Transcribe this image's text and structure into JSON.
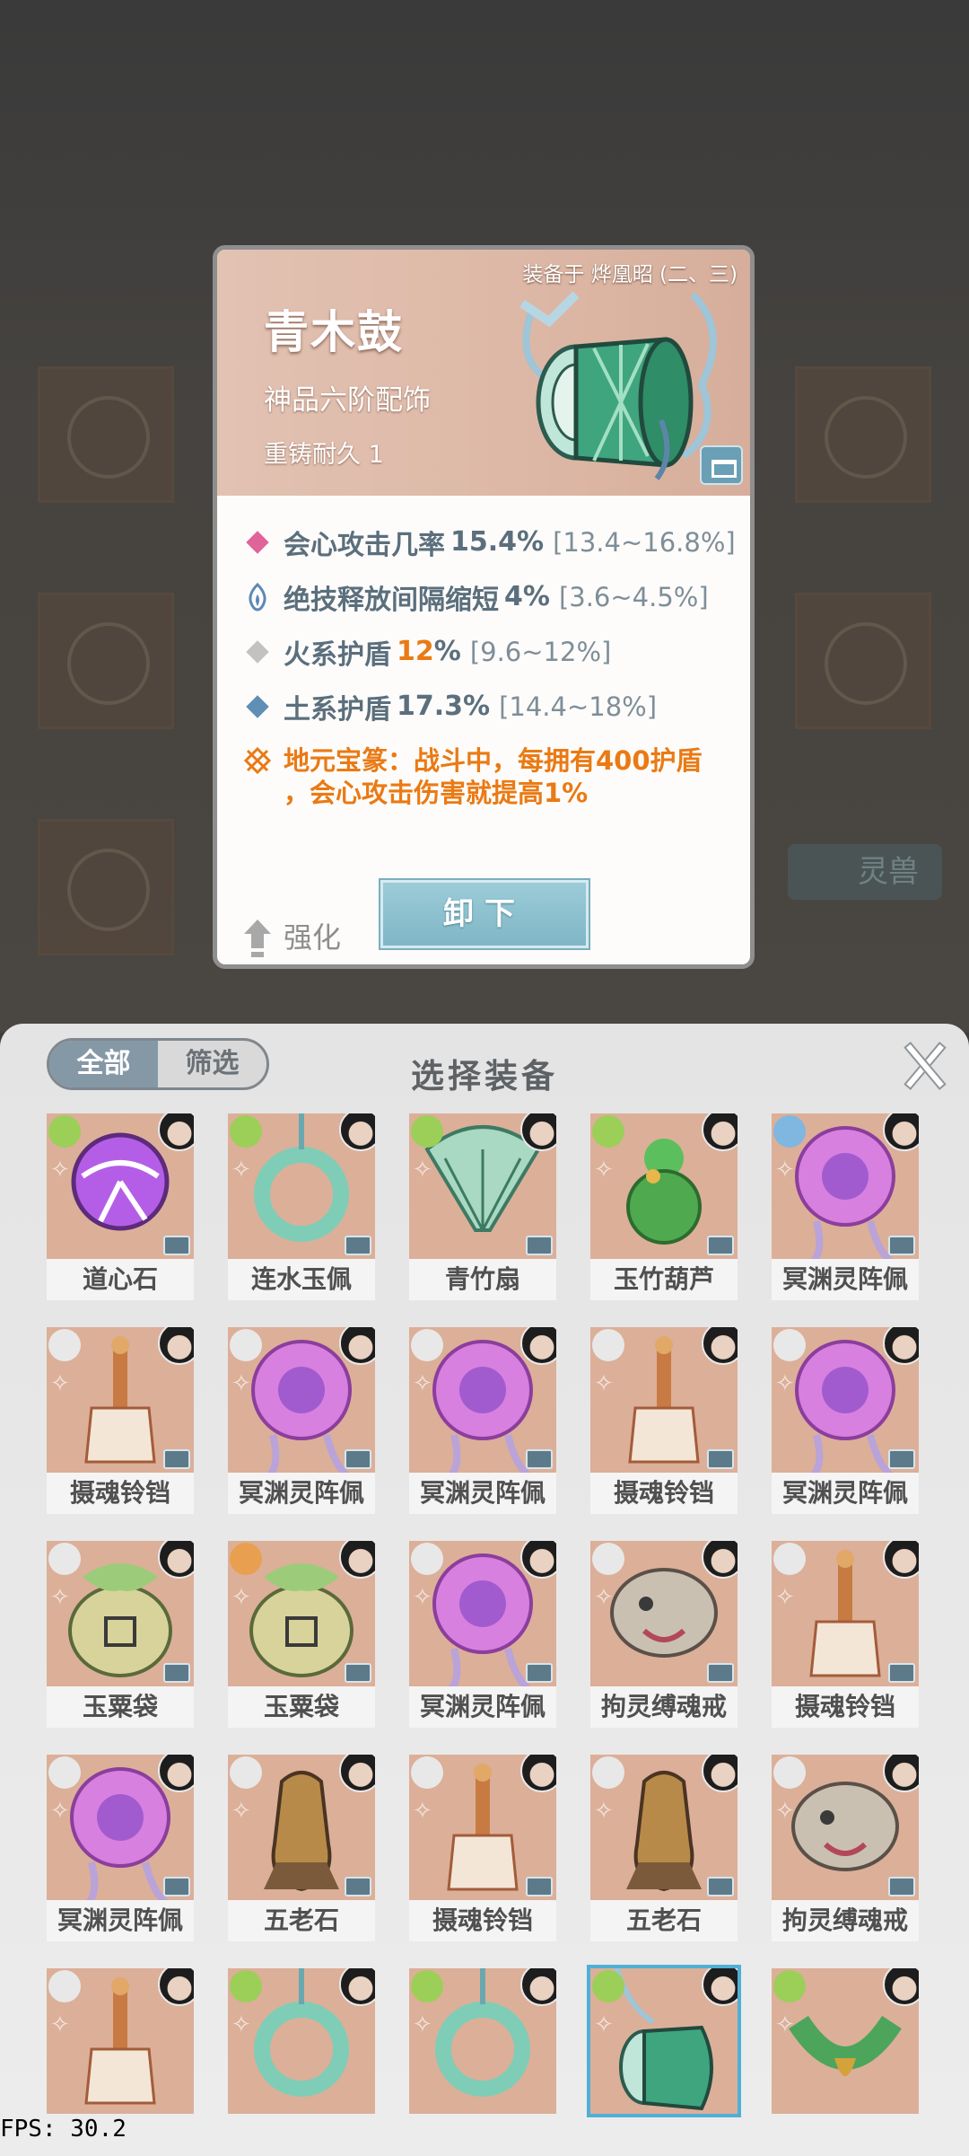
{
  "background": {
    "side_button_label": "灵兽"
  },
  "detail": {
    "equipped_on": "装备于 烨凰昭 (二、三)",
    "name": "青木鼓",
    "grade": "神品六阶配饰",
    "reforge": "重铸耐久 1",
    "stats": [
      {
        "icon": "pink-diamond-icon",
        "color": "#e0649a",
        "name": "会心攻击几率",
        "value": "15.4%",
        "range": "[13.4~16.8%]"
      },
      {
        "icon": "blue-flame-icon",
        "color": "#5c88b8",
        "name": "绝技释放间隔缩短",
        "value": "4%",
        "range": "[3.6~4.5%]"
      },
      {
        "icon": "gray-diamond-icon",
        "color": "#c2c2c2",
        "name": "火系护盾",
        "value_number": "12",
        "value_unit": "%",
        "range": "[9.6~12%]"
      },
      {
        "icon": "blue-diamond-icon",
        "color": "#5f8fb4",
        "name": "土系护盾",
        "value": "17.3%",
        "range": "[14.4~18%]"
      }
    ],
    "special_line1": "地元宝篆：战斗中，每拥有400护盾",
    "special_line2": "，会心攻击伤害就提高1%",
    "strengthen_label": "强化",
    "unload_label": "卸下"
  },
  "panel": {
    "title": "选择装备",
    "tabs": [
      "全部",
      "筛选"
    ],
    "items": [
      {
        "name": "道心石",
        "art": "purple-orb",
        "element": "#9ccf57"
      },
      {
        "name": "连水玉佩",
        "art": "jade-ring",
        "element": "#9ccf57"
      },
      {
        "name": "青竹扇",
        "art": "fan",
        "element": "#9ccf57"
      },
      {
        "name": "玉竹葫芦",
        "art": "gourd",
        "element": "#9ccf57"
      },
      {
        "name": "冥渊灵阵佩",
        "art": "pink-seal",
        "element": "#7fb7e0"
      },
      {
        "name": "摄魂铃铛",
        "art": "bell",
        "element": "#e8e8e8"
      },
      {
        "name": "冥渊灵阵佩",
        "art": "pink-seal",
        "element": "#e8e8e8"
      },
      {
        "name": "冥渊灵阵佩",
        "art": "pink-seal",
        "element": "#e8e8e8"
      },
      {
        "name": "摄魂铃铛",
        "art": "bell",
        "element": "#e8e8e8"
      },
      {
        "name": "冥渊灵阵佩",
        "art": "pink-seal",
        "element": "#e8e8e8"
      },
      {
        "name": "玉粟袋",
        "art": "sack",
        "element": "#e8e8e8"
      },
      {
        "name": "玉粟袋",
        "art": "sack",
        "element": "#e8a050"
      },
      {
        "name": "冥渊灵阵佩",
        "art": "pink-seal",
        "element": "#e8e8e8"
      },
      {
        "name": "拘灵缚魂戒",
        "art": "beast-ring",
        "element": "#e8e8e8"
      },
      {
        "name": "摄魂铃铛",
        "art": "bell",
        "element": "#e8e8e8"
      },
      {
        "name": "冥渊灵阵佩",
        "art": "pink-seal",
        "element": "#e8e8e8"
      },
      {
        "name": "五老石",
        "art": "stone",
        "element": "#e8e8e8"
      },
      {
        "name": "摄魂铃铛",
        "art": "bell",
        "element": "#e8e8e8"
      },
      {
        "name": "五老石",
        "art": "stone",
        "element": "#e8e8e8"
      },
      {
        "name": "拘灵缚魂戒",
        "art": "beast-ring",
        "element": "#e8e8e8"
      },
      {
        "name": "",
        "art": "bell",
        "element": "#e8e8e8"
      },
      {
        "name": "",
        "art": "jade-ring",
        "element": "#9ccf57"
      },
      {
        "name": "",
        "art": "jade-ring",
        "element": "#9ccf57"
      },
      {
        "name": "",
        "art": "drum",
        "element": "#9ccf57"
      },
      {
        "name": "",
        "art": "green-pendant",
        "element": "#9ccf57"
      }
    ],
    "selected_index": 23
  },
  "fps_label": "FPS: 30.2"
}
